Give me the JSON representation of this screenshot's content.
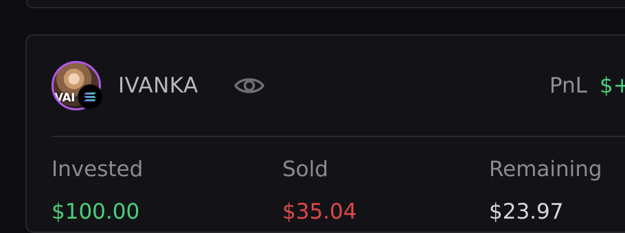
{
  "wallet": {
    "name": "IVANKA",
    "avatar_text": "VAI",
    "chain_icon": "solana-icon",
    "watch_icon": "eye-icon"
  },
  "pnl": {
    "label": "PnL",
    "value": "$+"
  },
  "stats": {
    "invested": {
      "label": "Invested",
      "value": "$100.00"
    },
    "sold": {
      "label": "Sold",
      "value": "$35.04"
    },
    "remaining": {
      "label": "Remaining",
      "value": "$23.97"
    }
  },
  "colors": {
    "positive": "#4bd07a",
    "negative": "#e04848",
    "neutral": "#d8d8dc",
    "avatar_ring": "#b05ae8"
  }
}
